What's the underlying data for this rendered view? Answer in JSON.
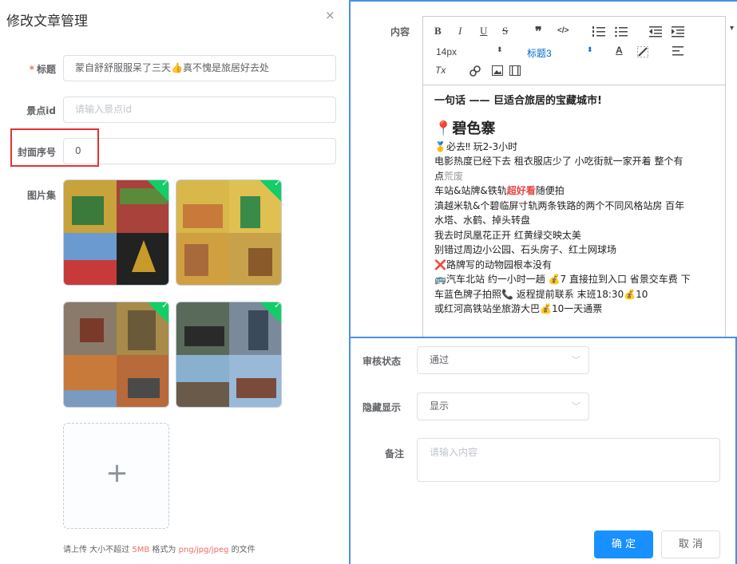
{
  "left": {
    "title": "修改文章管理",
    "close": "×",
    "fields": {
      "title_label": "标题",
      "title_required": "*",
      "title_value": "蒙自舒舒服服呆了三天👍真不愧是旅居好去处",
      "spot_label": "景点id",
      "spot_placeholder": "请输入景点id",
      "cover_label": "封面序号",
      "cover_value": "0",
      "gallery_label": "图片集"
    },
    "upload": {
      "plus": "+",
      "tip_prefix": "请上传 大小不超过",
      "tip_size": "5MB",
      "tip_mid": "格式为",
      "tip_formats": "png/jpg/jpeg",
      "tip_suffix": "的文件"
    }
  },
  "right": {
    "content_label": "内容",
    "toolbar": {
      "bold": "B",
      "italic": "I",
      "underline": "U",
      "strike": "S",
      "quote": "❞",
      "code": "</>",
      "font_size": "14px",
      "heading": "标题3",
      "clean": "Tx"
    },
    "editor_lines": {
      "l1": "一句话 —— 巨适合旅居的宝藏城市!",
      "l2": "碧色寨",
      "l3": "🥇必去‼ 玩2-3小时",
      "l4": "电影热度已经下去 租衣服店少了 小吃街就一家开着 整个有",
      "l5a": "点",
      "l5b": "荒废",
      "l6a": "车站&站牌&铁轨",
      "l6b": "超好看",
      "l6c": "随便拍",
      "l7": "滇越米轨&个碧临屏寸轨两条铁路的两个不同风格站房 百年",
      "l8": "水塔、水鹤、掉头转盘",
      "l9": "我去时凤凰花正开 红黄绿交映太美",
      "l10": "别错过周边小公园、石头房子、红土网球场",
      "l11": "❌路牌写的动物园根本没有",
      "l12": "🚌汽车北站 约一小时一趟 💰7 直接拉到入口 省景交车费 下",
      "l13": "车蓝色牌子拍照📞 返程提前联系 末班18:30💰10",
      "l14": "或红河高铁站坐旅游大巴💰10一天通票"
    }
  },
  "panel": {
    "review_label": "审核状态",
    "review_value": "通过",
    "hide_label": "隐藏显示",
    "hide_value": "显示",
    "remark_label": "备注",
    "remark_placeholder": "请输入内容",
    "ok": "确 定",
    "cancel": "取 消"
  },
  "colors": {
    "primary": "#1890ff",
    "danger": "#f56c6c",
    "success": "#13ce66",
    "highlight": "#e53232",
    "accent_border": "#4a90e2"
  }
}
